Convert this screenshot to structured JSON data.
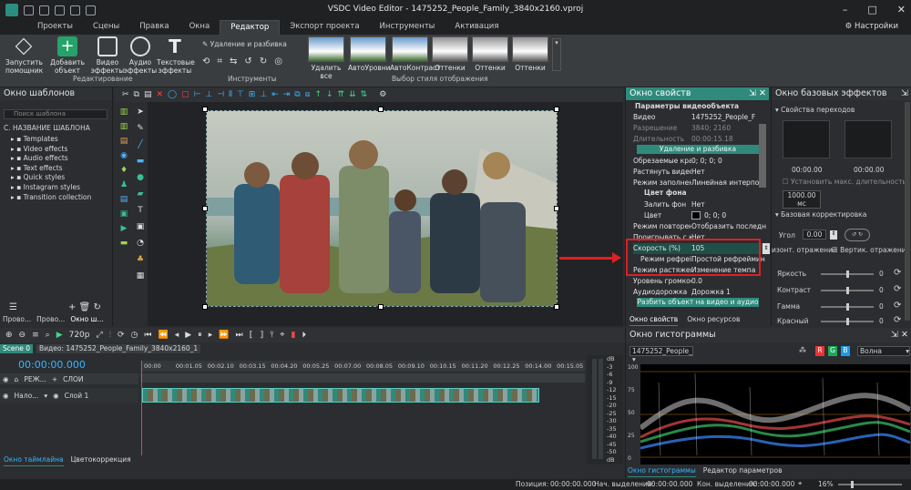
{
  "app": {
    "title": "VSDC Video Editor - 1475252_People_Family_3840x2160.vproj",
    "settings": "Настройки"
  },
  "menu": [
    "Проекты",
    "Сцены",
    "Правка",
    "Окна",
    "Редактор",
    "Экспорт проекта",
    "Инструменты",
    "Активация"
  ],
  "ribbon": {
    "buttons": [
      "Запустить помощник",
      "Добавить объект",
      "Видео эффекты",
      "Аудио эффекты",
      "Текстовые эффекты"
    ],
    "group_editing": "Редактирование",
    "tools_title": "Удаление и разбивка",
    "group_tools": "Инструменты",
    "styles": [
      "Удалить все",
      "АвтоУровни",
      "АвтоКонтраст",
      "Оттенки",
      "Оттенки",
      "Оттенки"
    ],
    "group_styles": "Выбор стиля отображения"
  },
  "templates": {
    "title": "Окно шаблонов",
    "search_placeholder": "Поиск шаблона",
    "header": "С. НАЗВАНИЕ ШАБЛОНА",
    "items": [
      "Templates",
      "Video effects",
      "Audio effects",
      "Text effects",
      "Quick styles",
      "Instagram styles",
      "Transition collection"
    ],
    "tabs": [
      "Прово...",
      "Прово...",
      "Окно ш..."
    ]
  },
  "preview": {
    "resolution": "720p"
  },
  "properties": {
    "title": "Окно свойств",
    "section": "Параметры видеообъекта",
    "rows": [
      {
        "k": "Видео",
        "v": "1475252_People_F"
      },
      {
        "k": "Разрешение",
        "v": "3840; 2160"
      },
      {
        "k": "Длительность",
        "v": "00:00:15.18"
      }
    ],
    "btn_delete_split": "Удаление и разбивка",
    "rows2": [
      {
        "k": "Обрезаемые края",
        "v": "0; 0; 0; 0"
      },
      {
        "k": "Растянуть видео",
        "v": "Нет"
      },
      {
        "k": "Режим заполнени",
        "v": "Линейная интерпол"
      }
    ],
    "bg_section": "Цвет фона",
    "rows3": [
      {
        "k": "Залить фон",
        "v": "Нет"
      },
      {
        "k": "Цвет",
        "v": "0; 0; 0"
      },
      {
        "k": "Режим повторени",
        "v": "Отобразить последн"
      },
      {
        "k": "Проигрывать с кс",
        "v": "Нет"
      },
      {
        "k": "Скорость (%)",
        "v": "105"
      },
      {
        "k": "Режим рефреі",
        "v": "Простой рефреймин"
      },
      {
        "k": "Режим растяжени",
        "v": "Изменение темпа"
      },
      {
        "k": "Уровень громкос",
        "v": "0.0"
      },
      {
        "k": "Аудиодорожка",
        "v": "Дорожка 1"
      }
    ],
    "btn_split_av": "Разбить объект на видео и аудио",
    "tabs": [
      "Окно свойств",
      "Окно ресурсов"
    ]
  },
  "effects": {
    "title": "Окно базовых эффектов",
    "transitions": "Свойства переходов",
    "time1": "00:00.00",
    "time2": "00:00.00",
    "max_dur_label": "Установить макс. длительность:",
    "max_dur_value": "1000.00 мс",
    "basic": "Базовая корректировка",
    "angle_label": "Угол",
    "angle_value": "0.00",
    "flip_h": "изонт. отражение",
    "flip_v": "Вертик. отражение",
    "sliders": [
      {
        "label": "Яркость",
        "value": "0"
      },
      {
        "label": "Контраст",
        "value": "0"
      },
      {
        "label": "Гамма",
        "value": "0"
      },
      {
        "label": "Красный",
        "value": "0"
      }
    ]
  },
  "timeline": {
    "scene_tab": "Scene 0",
    "video_tab": "Видео: 1475252_People_Family_3840x2160_1",
    "time": "00:00:00.000",
    "layers_mode": "РЕЖ...",
    "layers": "СЛОИ",
    "track_mode": "Нало...",
    "track_name": "Слой 1",
    "ticks": [
      "00:00",
      "00:01.05",
      "00:02.10",
      "00:03.15",
      "00:04.20",
      "00:05.25",
      "00:07.00",
      "00:08.05",
      "00:09.10",
      "00:10.15",
      "00:11.20",
      "00:12.25",
      "00:14.00",
      "00:15.05"
    ],
    "meter_labels": [
      "dB",
      "-3",
      "-6",
      "-9",
      "-12",
      "-15",
      "-20",
      "-25",
      "-30",
      "-35",
      "-40",
      "-45",
      "-50",
      "dB"
    ],
    "tabs": [
      "Окно таймлайна",
      "Цветокоррекция"
    ]
  },
  "histogram": {
    "title": "Окно гистограммы",
    "source": "1475252_People_",
    "channels": [
      "R",
      "G",
      "B"
    ],
    "mode": "Волна",
    "scale": [
      "100",
      "75",
      "50",
      "25",
      "0"
    ],
    "tabs": [
      "Окно гистограммы",
      "Редактор параметров"
    ]
  },
  "status": {
    "position_label": "Позиция:",
    "position": "00:00:00.000",
    "sel_start_label": "Нач. выделения:",
    "sel_start": "00:00:00.000",
    "sel_end_label": "Кон. выделения:",
    "sel_end": "00:00:00.000",
    "zoom": "16%"
  }
}
